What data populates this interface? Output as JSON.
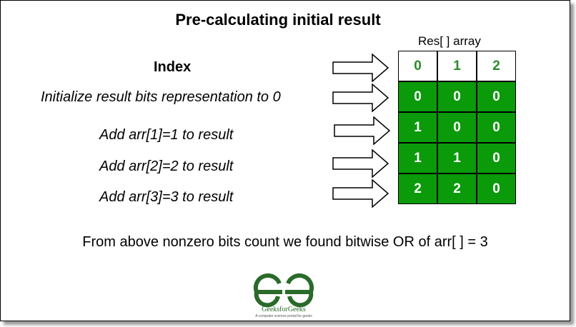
{
  "title": "Pre-calculating initial result",
  "array_caption": "Res[ ] array",
  "rows": [
    {
      "label": "Index",
      "cells": [
        "0",
        "1",
        "2"
      ]
    },
    {
      "label": "Initialize result bits representation to 0",
      "cells": [
        "0",
        "0",
        "0"
      ]
    },
    {
      "label": "Add arr[1]=1 to result",
      "cells": [
        "1",
        "0",
        "0"
      ]
    },
    {
      "label": "Add arr[2]=2 to result",
      "cells": [
        "1",
        "1",
        "0"
      ]
    },
    {
      "label": "Add arr[3]=3 to result",
      "cells": [
        "2",
        "2",
        "0"
      ]
    }
  ],
  "footer": "From above nonzero bits count we found bitwise OR of arr[ ] = 3",
  "logo": {
    "name": "GeeksforGeeks",
    "tagline": "A computer science portal for geeks"
  },
  "colors": {
    "cell_green": "#0a9a0a",
    "index_text": "#2a8a2a",
    "logo_green": "#2a6a2a"
  }
}
